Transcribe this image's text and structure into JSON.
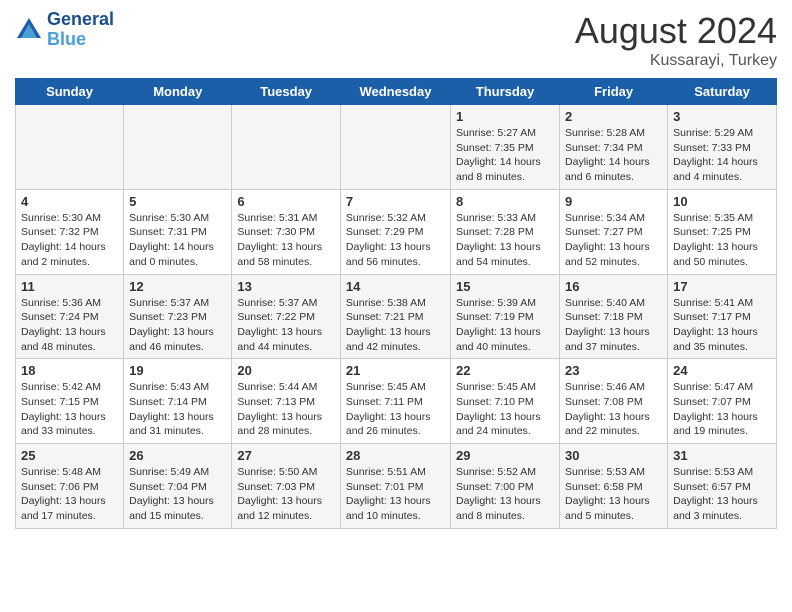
{
  "header": {
    "logo_line1": "General",
    "logo_line2": "Blue",
    "month_year": "August 2024",
    "location": "Kussarayi, Turkey"
  },
  "days_of_week": [
    "Sunday",
    "Monday",
    "Tuesday",
    "Wednesday",
    "Thursday",
    "Friday",
    "Saturday"
  ],
  "weeks": [
    [
      {
        "day": "",
        "info": ""
      },
      {
        "day": "",
        "info": ""
      },
      {
        "day": "",
        "info": ""
      },
      {
        "day": "",
        "info": ""
      },
      {
        "day": "1",
        "info": "Sunrise: 5:27 AM\nSunset: 7:35 PM\nDaylight: 14 hours\nand 8 minutes."
      },
      {
        "day": "2",
        "info": "Sunrise: 5:28 AM\nSunset: 7:34 PM\nDaylight: 14 hours\nand 6 minutes."
      },
      {
        "day": "3",
        "info": "Sunrise: 5:29 AM\nSunset: 7:33 PM\nDaylight: 14 hours\nand 4 minutes."
      }
    ],
    [
      {
        "day": "4",
        "info": "Sunrise: 5:30 AM\nSunset: 7:32 PM\nDaylight: 14 hours\nand 2 minutes."
      },
      {
        "day": "5",
        "info": "Sunrise: 5:30 AM\nSunset: 7:31 PM\nDaylight: 14 hours\nand 0 minutes."
      },
      {
        "day": "6",
        "info": "Sunrise: 5:31 AM\nSunset: 7:30 PM\nDaylight: 13 hours\nand 58 minutes."
      },
      {
        "day": "7",
        "info": "Sunrise: 5:32 AM\nSunset: 7:29 PM\nDaylight: 13 hours\nand 56 minutes."
      },
      {
        "day": "8",
        "info": "Sunrise: 5:33 AM\nSunset: 7:28 PM\nDaylight: 13 hours\nand 54 minutes."
      },
      {
        "day": "9",
        "info": "Sunrise: 5:34 AM\nSunset: 7:27 PM\nDaylight: 13 hours\nand 52 minutes."
      },
      {
        "day": "10",
        "info": "Sunrise: 5:35 AM\nSunset: 7:25 PM\nDaylight: 13 hours\nand 50 minutes."
      }
    ],
    [
      {
        "day": "11",
        "info": "Sunrise: 5:36 AM\nSunset: 7:24 PM\nDaylight: 13 hours\nand 48 minutes."
      },
      {
        "day": "12",
        "info": "Sunrise: 5:37 AM\nSunset: 7:23 PM\nDaylight: 13 hours\nand 46 minutes."
      },
      {
        "day": "13",
        "info": "Sunrise: 5:37 AM\nSunset: 7:22 PM\nDaylight: 13 hours\nand 44 minutes."
      },
      {
        "day": "14",
        "info": "Sunrise: 5:38 AM\nSunset: 7:21 PM\nDaylight: 13 hours\nand 42 minutes."
      },
      {
        "day": "15",
        "info": "Sunrise: 5:39 AM\nSunset: 7:19 PM\nDaylight: 13 hours\nand 40 minutes."
      },
      {
        "day": "16",
        "info": "Sunrise: 5:40 AM\nSunset: 7:18 PM\nDaylight: 13 hours\nand 37 minutes."
      },
      {
        "day": "17",
        "info": "Sunrise: 5:41 AM\nSunset: 7:17 PM\nDaylight: 13 hours\nand 35 minutes."
      }
    ],
    [
      {
        "day": "18",
        "info": "Sunrise: 5:42 AM\nSunset: 7:15 PM\nDaylight: 13 hours\nand 33 minutes."
      },
      {
        "day": "19",
        "info": "Sunrise: 5:43 AM\nSunset: 7:14 PM\nDaylight: 13 hours\nand 31 minutes."
      },
      {
        "day": "20",
        "info": "Sunrise: 5:44 AM\nSunset: 7:13 PM\nDaylight: 13 hours\nand 28 minutes."
      },
      {
        "day": "21",
        "info": "Sunrise: 5:45 AM\nSunset: 7:11 PM\nDaylight: 13 hours\nand 26 minutes."
      },
      {
        "day": "22",
        "info": "Sunrise: 5:45 AM\nSunset: 7:10 PM\nDaylight: 13 hours\nand 24 minutes."
      },
      {
        "day": "23",
        "info": "Sunrise: 5:46 AM\nSunset: 7:08 PM\nDaylight: 13 hours\nand 22 minutes."
      },
      {
        "day": "24",
        "info": "Sunrise: 5:47 AM\nSunset: 7:07 PM\nDaylight: 13 hours\nand 19 minutes."
      }
    ],
    [
      {
        "day": "25",
        "info": "Sunrise: 5:48 AM\nSunset: 7:06 PM\nDaylight: 13 hours\nand 17 minutes."
      },
      {
        "day": "26",
        "info": "Sunrise: 5:49 AM\nSunset: 7:04 PM\nDaylight: 13 hours\nand 15 minutes."
      },
      {
        "day": "27",
        "info": "Sunrise: 5:50 AM\nSunset: 7:03 PM\nDaylight: 13 hours\nand 12 minutes."
      },
      {
        "day": "28",
        "info": "Sunrise: 5:51 AM\nSunset: 7:01 PM\nDaylight: 13 hours\nand 10 minutes."
      },
      {
        "day": "29",
        "info": "Sunrise: 5:52 AM\nSunset: 7:00 PM\nDaylight: 13 hours\nand 8 minutes."
      },
      {
        "day": "30",
        "info": "Sunrise: 5:53 AM\nSunset: 6:58 PM\nDaylight: 13 hours\nand 5 minutes."
      },
      {
        "day": "31",
        "info": "Sunrise: 5:53 AM\nSunset: 6:57 PM\nDaylight: 13 hours\nand 3 minutes."
      }
    ]
  ]
}
